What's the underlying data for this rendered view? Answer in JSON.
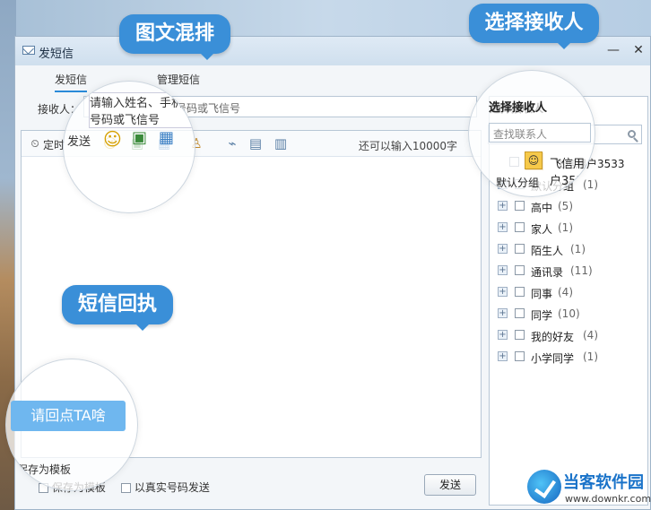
{
  "window": {
    "title": "发短信",
    "min_label": "—",
    "close_label": "✕"
  },
  "tabs": [
    {
      "label": "发短信",
      "active": true
    },
    {
      "label": "管理短信",
      "active": false
    }
  ],
  "receiver": {
    "label": "接收人：",
    "placeholder": "请输入姓名、手机号码或飞信号"
  },
  "toolbar": {
    "timer_label": "定时",
    "send_label": "发送",
    "char_hint": "还可以输入10000字"
  },
  "bottom": {
    "save_template": "保存为模板",
    "real_number": "以真实号码发送",
    "send_button": "发送"
  },
  "contacts": {
    "title": "选择接收人",
    "search_placeholder": "查找联系人",
    "user": "飞信用户3533",
    "groups": [
      {
        "name": "默认分组",
        "count": "(1)"
      },
      {
        "name": "高中",
        "count": "(5)"
      },
      {
        "name": "家人",
        "count": "(1)"
      },
      {
        "name": "陌生人",
        "count": "(1)"
      },
      {
        "name": "通讯录",
        "count": "(11)"
      },
      {
        "name": "同事",
        "count": "(4)"
      },
      {
        "name": "同学",
        "count": "(10)"
      },
      {
        "name": "我的好友",
        "count": "(4)"
      },
      {
        "name": "小学同学",
        "count": "(1)"
      }
    ]
  },
  "callouts": {
    "mixed": "图文混排",
    "choose": "选择接收人",
    "receipt": "短信回执",
    "quick_reply": "请回点TA啥"
  },
  "watermark": {
    "title": "当客软件园",
    "url": "www.downkr.com"
  },
  "colors": {
    "accent": "#3a8fd8",
    "quick_reply": "#6fb7ef"
  }
}
